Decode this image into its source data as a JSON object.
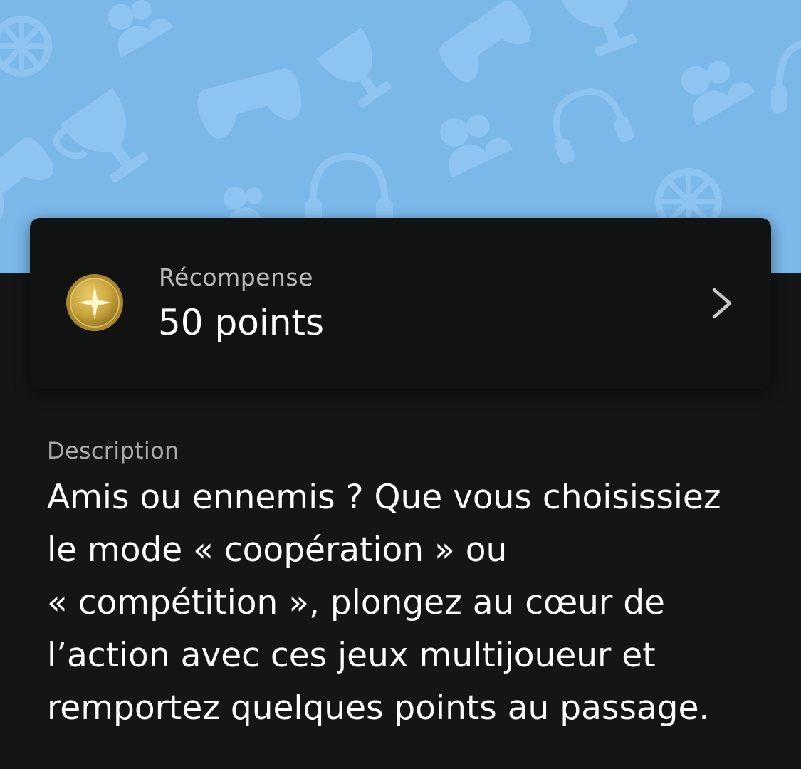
{
  "colors": {
    "banner_bg": "#7bb8ea",
    "banner_pattern": "#8dc4f1",
    "page_bg": "#141515",
    "card_bg": "#111212",
    "coin_gold": "#c9a53c"
  },
  "banner": {
    "pattern_icons": [
      "controller-icon",
      "trophy-icon",
      "headset-icon",
      "globe-icon",
      "friends-icon"
    ]
  },
  "reward": {
    "icon": "gold-star-coin-icon",
    "label": "Récompense",
    "value": "50 points",
    "chevron_icon": "chevron-right-icon"
  },
  "description": {
    "label": "Description",
    "lines": [
      "Amis ou ennemis ? Que vous choisissiez",
      "le mode « coopération » ou",
      "« compétition », plongez au cœur de",
      "l’action avec ces jeux multijoueur et",
      "remportez quelques points au passage."
    ]
  }
}
